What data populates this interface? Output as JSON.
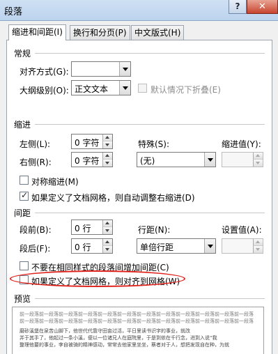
{
  "dialog": {
    "title": "段落",
    "help": "?",
    "close": "✕"
  },
  "tabs": [
    {
      "label": "缩进和间距(I)"
    },
    {
      "label": "换行和分页(P)"
    },
    {
      "label": "中文版式(H)"
    }
  ],
  "general": {
    "section": "常规",
    "alignment_label": "对齐方式(G):",
    "alignment_value": "",
    "outline_label": "大纲级别(O):",
    "outline_value": "正文文本",
    "collapsed_label": "默认情况下折叠(E)"
  },
  "indent": {
    "section": "缩进",
    "left_label": "左侧(L):",
    "left_value": "0 字符",
    "right_label": "右侧(R):",
    "right_value": "0 字符",
    "special_label": "特殊(S):",
    "special_value": "(无)",
    "by_label": "缩进值(Y):",
    "by_value": "",
    "mirror_label": "对称缩进(M)",
    "auto_adjust_label": "如果定义了文档网格，则自动调整右缩进(D)"
  },
  "spacing": {
    "section": "间距",
    "before_label": "段前(B):",
    "before_value": "0 行",
    "after_label": "段后(F):",
    "after_value": "0 行",
    "line_label": "行距(N):",
    "line_value": "单倍行距",
    "at_label": "设置值(A):",
    "at_value": "",
    "no_space_label": "不要在相同样式的段落间增加间距(C)",
    "snap_grid_label": "如果定义了文档网格，则对齐到网格(W)"
  },
  "preview": {
    "section": "预览",
    "lines": [
      "前一段落前一段落前一段落前一段落前一段落前一段落前一段落前一段落前一段落前一段落前一段落前一段落",
      "前一段落前一段落前一段落前一段落前一段落前一段落前一段落前一段落前一段落前一段落前一段落前一段落",
      "磨砂溪堡在泉苦山脚下，他世代代靠守田亩过活，平日里读书识字的事业，就改",
      "并于其手了，他起过一条小溪，便以一位诸兄人在庭院里，于是到依在千行念，进到入说“我",
      "整理他要的事业，李自被骑的精神感动，常常去他家里坐坐，蔡者对于人，想把发现自在种，为就"
    ]
  },
  "colors": {
    "highlight": "#e0231c"
  }
}
